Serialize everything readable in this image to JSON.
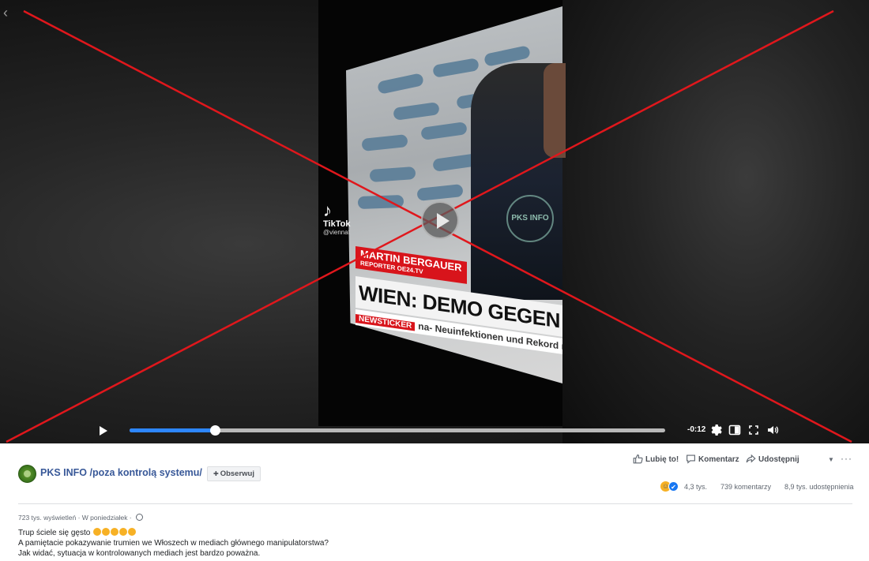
{
  "video": {
    "tiktok_label": "TikTok",
    "tiktok_handle": "@viennat",
    "reporter_name": "MARTIN BERGAUER",
    "reporter_sub": "REPORTER OE24.TV",
    "headline": "WIEN: DEMO GEGEN KLIMAP",
    "ticker_tag": "NEWSTICKER",
    "ticker_text": "na- Neuinfektionen und Rekord mi",
    "watermark": "PKS INFO",
    "progress_fraction": 0.16,
    "time_remaining": "-0:12",
    "cross_color": "#e0171c"
  },
  "post": {
    "page_name": "PKS INFO /poza kontrolą systemu/",
    "follow_label": "Obserwuj",
    "actions": {
      "like": "Lubię to!",
      "comment": "Komentarz",
      "share": "Udostępnij"
    },
    "stats": {
      "reactions": "4,3 tys.",
      "comments": "739 komentarzy",
      "shares": "8,9 tys. udostępnienia"
    },
    "meta": {
      "views": "723 tys. wyświetleń",
      "separator": " · ",
      "date": "W poniedziałek",
      "separator2": " · "
    },
    "text": {
      "line1": "Trup ściele się gęsto",
      "line2": "A pamiętacie pokazywanie trumien we Włoszech w mediach głównego manipulatorstwa?",
      "line3": "Jak widać, sytuacja w kontrolowanych mediach jest bardzo poważna."
    }
  },
  "colors": {
    "link": "#385898",
    "progress": "#2d86ff",
    "like_blue": "#1877f2"
  }
}
